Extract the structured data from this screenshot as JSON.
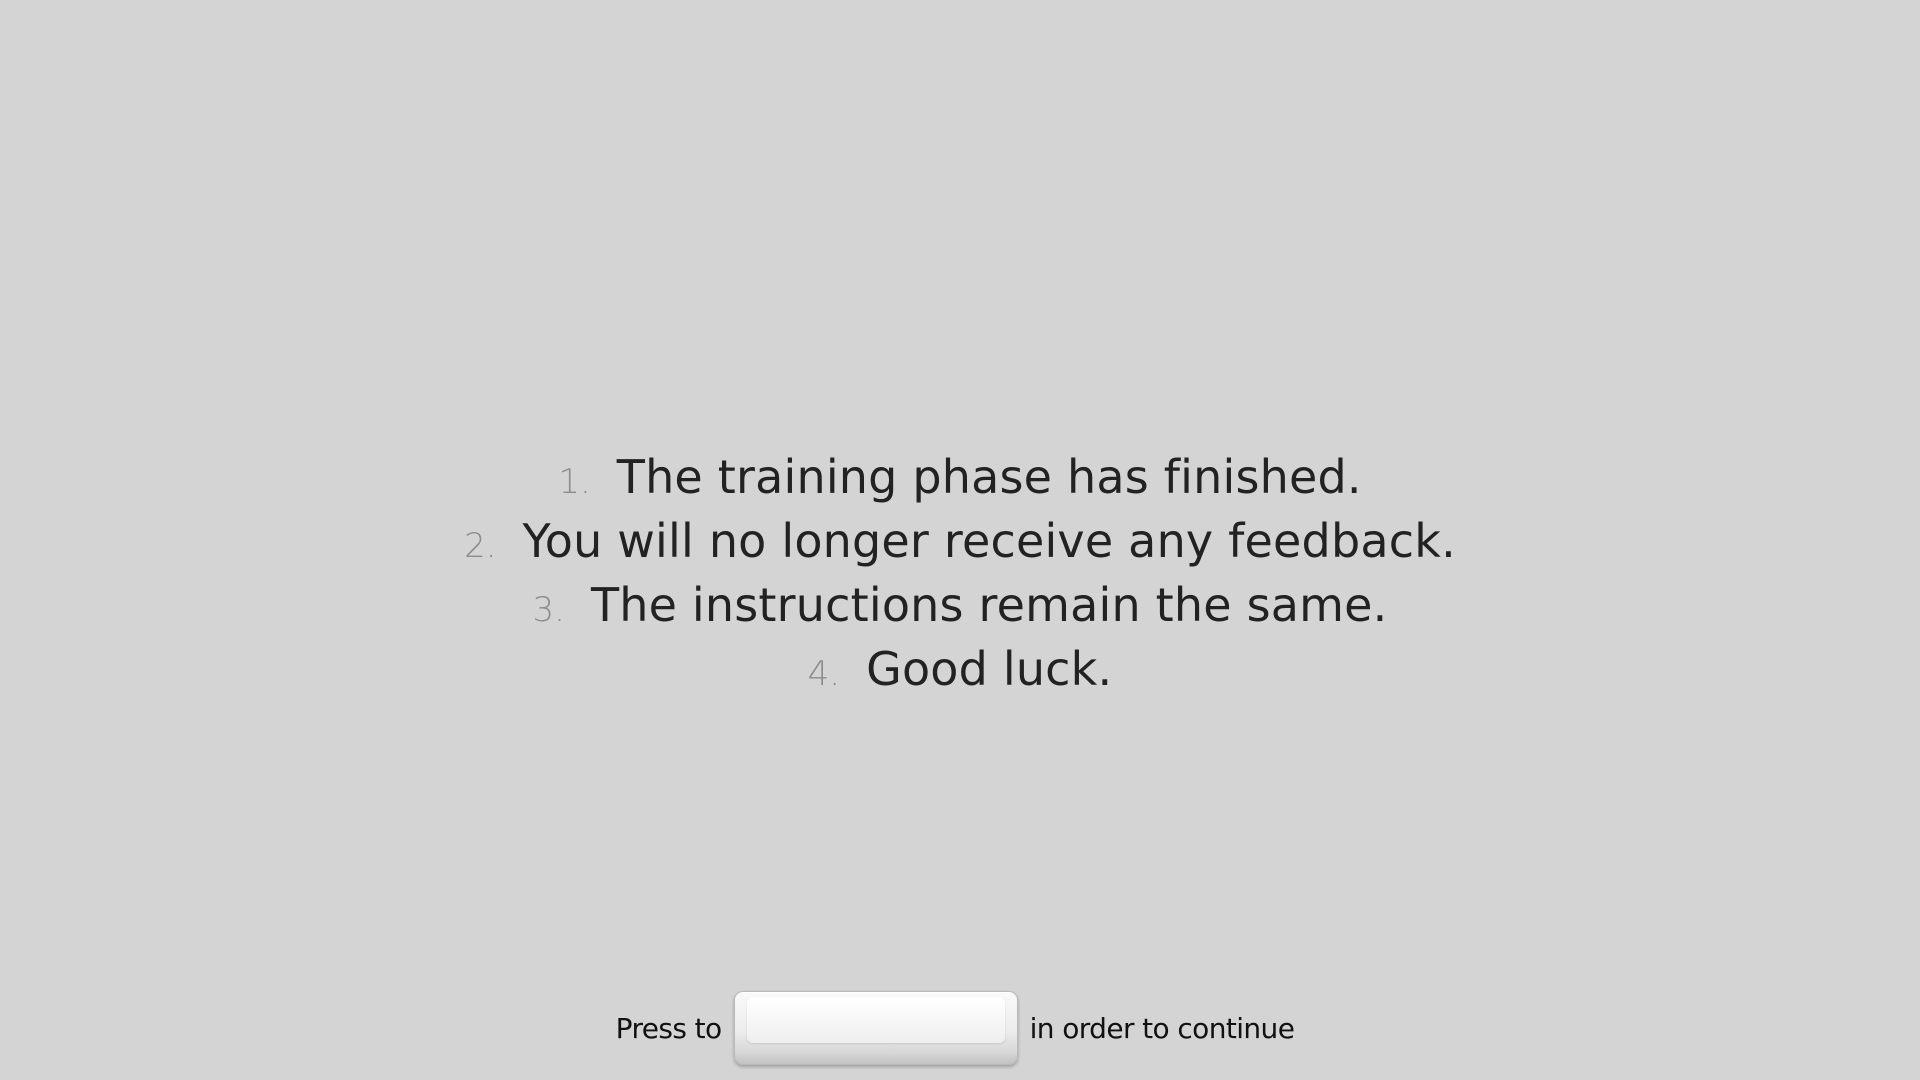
{
  "instructions": [
    {
      "number": "1.",
      "text": "The training phase has finished."
    },
    {
      "number": "2.",
      "text": "You will no longer receive any feedback."
    },
    {
      "number": "3.",
      "text": "The instructions remain the same."
    },
    {
      "number": "4.",
      "text": "Good luck."
    }
  ],
  "footer": {
    "prefix": "Press to",
    "key_icon": "spacebar-key-icon",
    "suffix": "in order to continue"
  },
  "colors": {
    "background": "#d4d4d4",
    "text": "#222222",
    "number": "#8c8c8c"
  }
}
